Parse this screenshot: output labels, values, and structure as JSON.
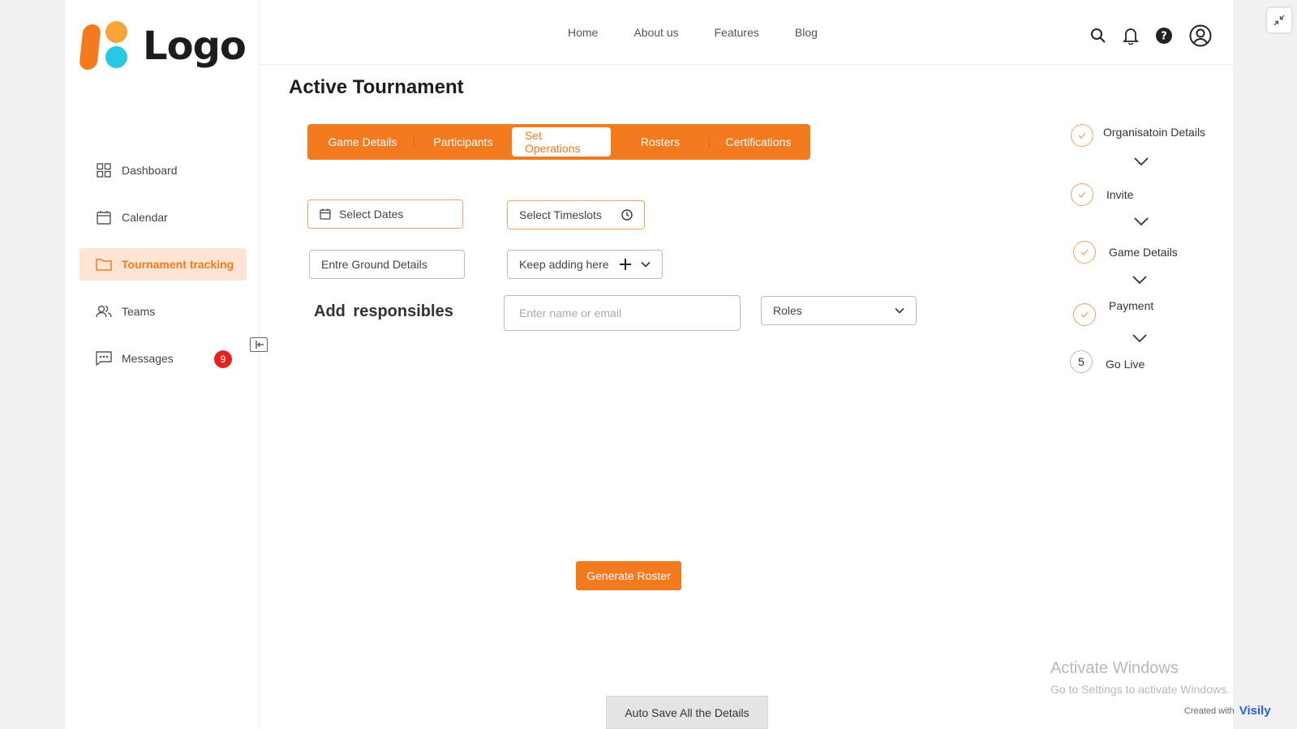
{
  "brand": {
    "logo_text": "Logo"
  },
  "sidebar": {
    "items": [
      {
        "label": "Dashboard",
        "icon": "grid-icon"
      },
      {
        "label": "Calendar",
        "icon": "calendar-icon"
      },
      {
        "label": "Tournament tracking",
        "icon": "folder-icon"
      },
      {
        "label": "Teams",
        "icon": "users-icon"
      },
      {
        "label": "Messages",
        "icon": "chat-icon",
        "badge": "9"
      }
    ]
  },
  "header": {
    "nav": [
      "Home",
      "About us",
      "Features",
      "Blog"
    ]
  },
  "main": {
    "title": "Active Tournament",
    "tabs": [
      "Game Details",
      "Participants",
      "Set Operations",
      "Rosters",
      "Certifications"
    ],
    "active_tab": "Set Operations",
    "select_dates": "Select Dates",
    "select_timeslots": "Select Timeslots",
    "ground_details": "Entre Ground Details",
    "keep_adding": "Keep adding here",
    "add_responsibles": "Add  responsibles",
    "name_email_placeholder": "Enter name or email",
    "roles": "Roles",
    "generate_roster": "Generate Roster",
    "auto_save": "Auto Save All the Details"
  },
  "stepper": {
    "steps": [
      {
        "label": "Organisatoin Details",
        "state": "done"
      },
      {
        "label": "Invite",
        "state": "done"
      },
      {
        "label": "Game Details",
        "state": "done"
      },
      {
        "label": "Payment",
        "state": "done"
      },
      {
        "label": "Go Live",
        "state": "pending",
        "number": "5"
      }
    ]
  },
  "overlay": {
    "activate_title": "Activate Windows",
    "activate_sub": "Go to Settings to activate Windows.",
    "created_with": "Created with",
    "visily_brand": "Visily"
  },
  "colors": {
    "accent": "#f47a20",
    "accent_light": "#fde4d3",
    "badge": "#e52222",
    "logo_cyan": "#27c8e0"
  }
}
